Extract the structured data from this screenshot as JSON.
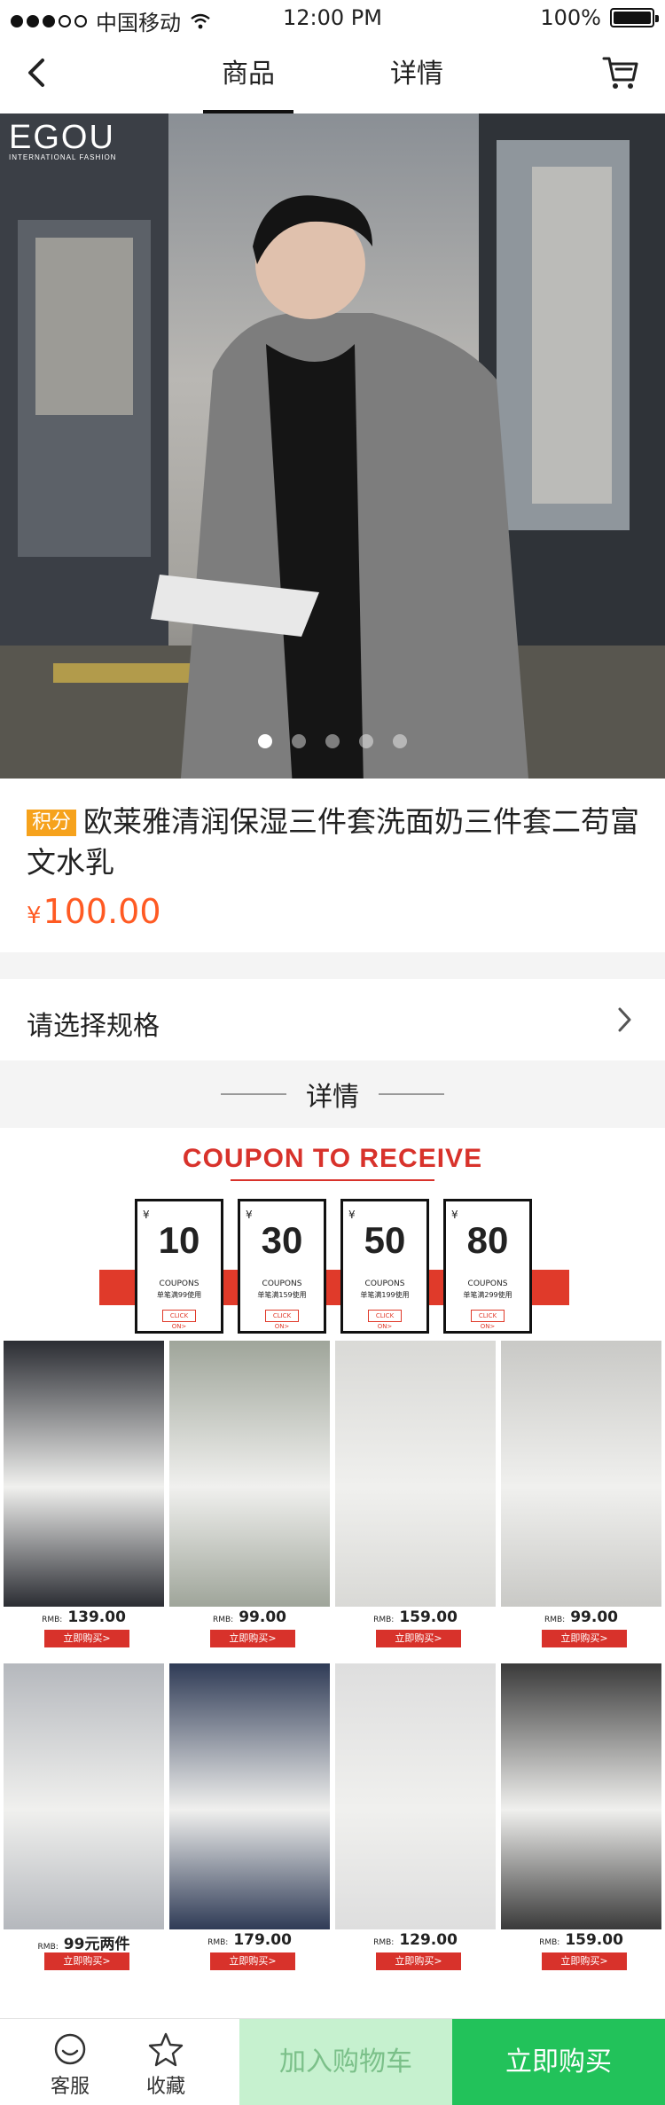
{
  "status_bar": {
    "carrier": "中国移动",
    "time": "12:00 PM",
    "battery": "100%"
  },
  "nav": {
    "tabs": [
      {
        "label": "商品",
        "active": true
      },
      {
        "label": "详情",
        "active": false
      }
    ]
  },
  "hero": {
    "brand": "EGOU",
    "brand_tagline": "INTERNATIONAL FASHION",
    "pages": 5,
    "current_page": 1
  },
  "product": {
    "badge": "积分",
    "title": "欧莱雅清润保湿三件套洗面奶三件套二苟富文水乳",
    "price_currency": "¥",
    "price": "100.00"
  },
  "spec": {
    "label": "请选择规格"
  },
  "detail_header": {
    "label": "详情"
  },
  "promo": {
    "title": "COUPON TO RECEIVE",
    "coupons": [
      {
        "currency": "¥",
        "amount": "10",
        "label": "COUPONS",
        "condition": "单笔满99使用",
        "claim": "CLICK ON>"
      },
      {
        "currency": "¥",
        "amount": "30",
        "label": "COUPONS",
        "condition": "单笔满159使用",
        "claim": "CLICK ON>"
      },
      {
        "currency": "¥",
        "amount": "50",
        "label": "COUPONS",
        "condition": "单笔满199使用",
        "claim": "CLICK ON>"
      },
      {
        "currency": "¥",
        "amount": "80",
        "label": "COUPONS",
        "condition": "单笔满299使用",
        "claim": "CLICK ON>"
      }
    ],
    "items": [
      {
        "rmb": "RMB:",
        "price": "139.00",
        "buy": "立即购买>",
        "tone": "#2b2d33"
      },
      {
        "rmb": "RMB:",
        "price": "99.00",
        "buy": "立即购买>",
        "tone": "#9fa59a"
      },
      {
        "rmb": "RMB:",
        "price": "159.00",
        "buy": "立即购买>",
        "tone": "#d9d9d6"
      },
      {
        "rmb": "RMB:",
        "price": "99.00",
        "buy": "立即购买>",
        "tone": "#c9c9c6"
      },
      {
        "rmb": "RMB:",
        "price": "99元两件",
        "buy": "立即购买>",
        "tone": "#b5b8bd"
      },
      {
        "rmb": "RMB:",
        "price": "179.00",
        "buy": "立即购买>",
        "tone": "#2f3b56"
      },
      {
        "rmb": "RMB:",
        "price": "129.00",
        "buy": "立即购买>",
        "tone": "#dedede"
      },
      {
        "rmb": "RMB:",
        "price": "159.00",
        "buy": "立即购买>",
        "tone": "#3a3a3a"
      }
    ]
  },
  "bottom_bar": {
    "service": "客服",
    "favorite": "收藏",
    "add_to_cart": "加入购物车",
    "buy_now": "立即购买",
    "colors": {
      "add_to_cart_bg": "#c6f1cf",
      "buy_now_bg": "#22c25a",
      "price": "#ff5a23"
    }
  }
}
